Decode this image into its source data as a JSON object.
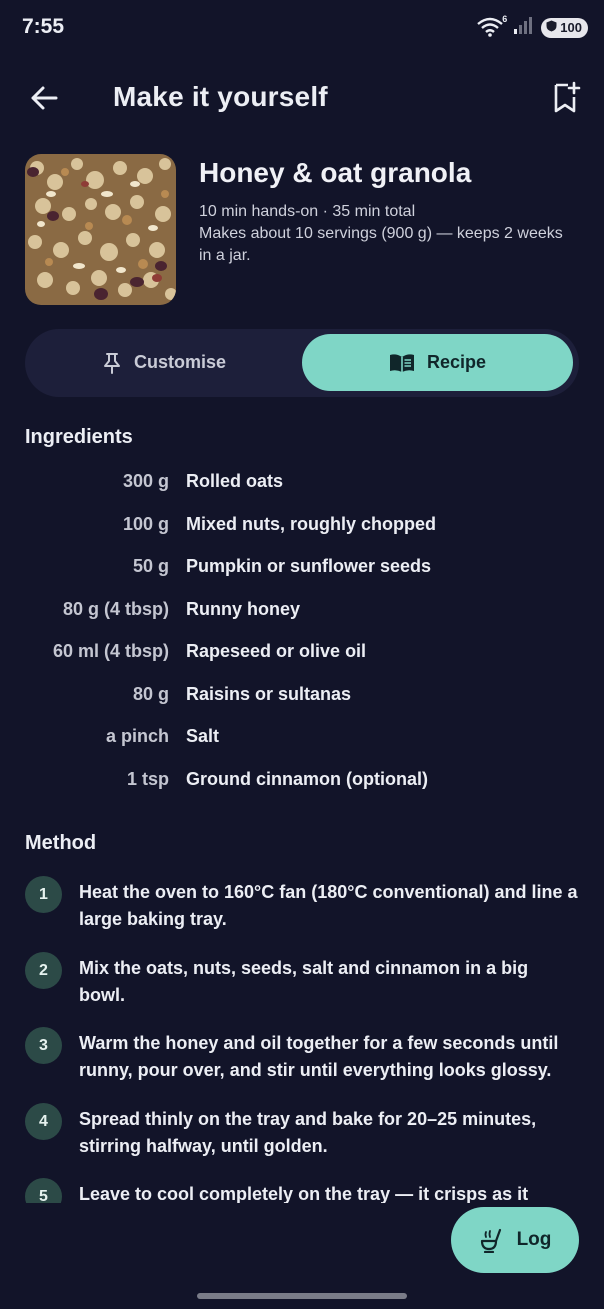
{
  "status": {
    "time": "7:55",
    "wifi_badge": "6",
    "battery": "100"
  },
  "header": {
    "title": "Make it yourself",
    "back_icon": "arrow-left-icon",
    "bookmark_icon": "bookmark-add-icon"
  },
  "recipe": {
    "title": "Honey & oat granola",
    "meta_time": "10 min hands-on · 35 min total",
    "meta_yield": "Makes about 10 servings (900 g) — keeps 2 weeks in a jar."
  },
  "tabs": [
    {
      "label": "Customise",
      "icon": "pin-icon",
      "selected": false
    },
    {
      "label": "Recipe",
      "icon": "book-open-icon",
      "selected": true
    }
  ],
  "ingredients": {
    "heading": "Ingredients",
    "items": [
      {
        "qty": "300 g",
        "name": "Rolled oats"
      },
      {
        "qty": "100 g",
        "name": "Mixed nuts, roughly chopped"
      },
      {
        "qty": "50 g",
        "name": "Pumpkin or sunflower seeds"
      },
      {
        "qty": "80 g (4 tbsp)",
        "name": "Runny honey"
      },
      {
        "qty": "60 ml (4 tbsp)",
        "name": "Rapeseed or olive oil"
      },
      {
        "qty": "80 g",
        "name": "Raisins or sultanas"
      },
      {
        "qty": "a pinch",
        "name": "Salt"
      },
      {
        "qty": "1 tsp",
        "name": "Ground cinnamon (optional)"
      }
    ]
  },
  "method": {
    "heading": "Method",
    "steps": [
      {
        "num": "1",
        "text": "Heat the oven to 160°C fan (180°C conventional) and line a large baking tray."
      },
      {
        "num": "2",
        "text": "Mix the oats, nuts, seeds, salt and cinnamon in a big bowl."
      },
      {
        "num": "3",
        "text": "Warm the honey and oil together for a few seconds until runny, pour over, and stir until everything looks glossy."
      },
      {
        "num": "4",
        "text": "Spread thinly on the tray and bake for 20–25 minutes, stirring halfway, until golden."
      },
      {
        "num": "5",
        "text": "Leave to cool completely on the tray — it crisps as it"
      }
    ]
  },
  "fab": {
    "label": "Log",
    "icon": "ladle-icon"
  },
  "colors": {
    "background": "#121429",
    "accent": "#7fd6c6",
    "step_badge": "#2c4a47"
  }
}
